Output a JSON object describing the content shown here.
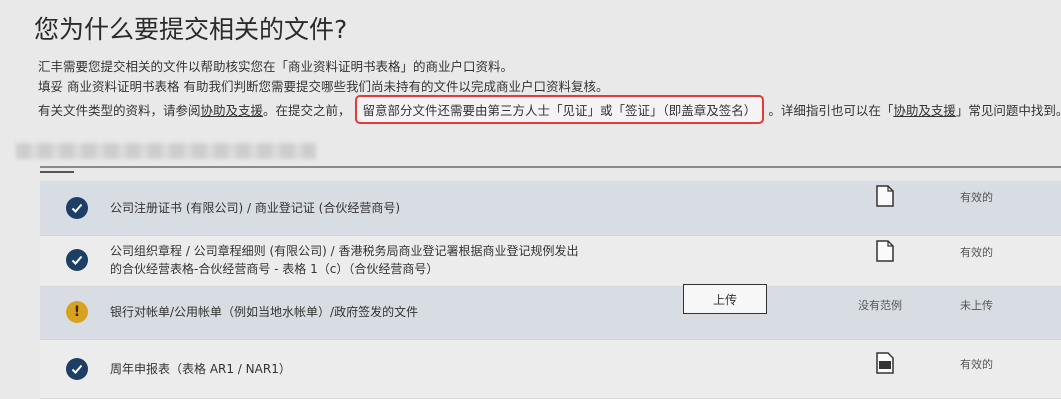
{
  "page_title": "您为什么要提交相关的文件?",
  "intro": {
    "line1": "汇丰需要您提交相关的文件以帮助核实您在「商业资料证明书表格」的商业户口资料。",
    "line2_prefix": "填妥",
    "line2_rest": "商业资料证明书表格 有助我们判断您需要提交哪些我们尚未持有的文件以完成商业户口资料复核。",
    "line3_a": "有关文件类型的资料，请参阅",
    "line3_link": "协助及支援",
    "line3_b": "。在提交之前，",
    "line3_highlight": "留意部分文件还需要由第三方人士「见证」或「签证」（即盖章及签名）",
    "line3_c": "。详细指引也可以在「",
    "line3_link2": "协助及支援",
    "line3_d": "」常见问题中找到。"
  },
  "documents": [
    {
      "label": "公司注册证书 (有限公司) / 商业登记证 (合伙经营商号)",
      "status": "有效的",
      "state": "ok"
    },
    {
      "label_line1": "公司组织章程 / 公司章程细则 (有限公司) / 香港税务局商业登记署根据商业登记规例发出",
      "label_line2": "的合伙经营表格-合伙经营商号 - 表格 1（c）（合伙经营商号）",
      "status": "有效的",
      "state": "ok"
    },
    {
      "label": "银行对帐单/公用帐单（例如当地水帐单）/政府签发的文件",
      "upload_label": "上传",
      "sample": "没有范例",
      "status": "未上传",
      "state": "warn"
    },
    {
      "label": "周年申报表（表格 AR1 / NAR1）",
      "status": "有效的",
      "state": "ok"
    }
  ],
  "colors": {
    "check_bg": "#1d3f66",
    "warn_bg": "#d9a21e",
    "highlight_border": "#e53935"
  }
}
